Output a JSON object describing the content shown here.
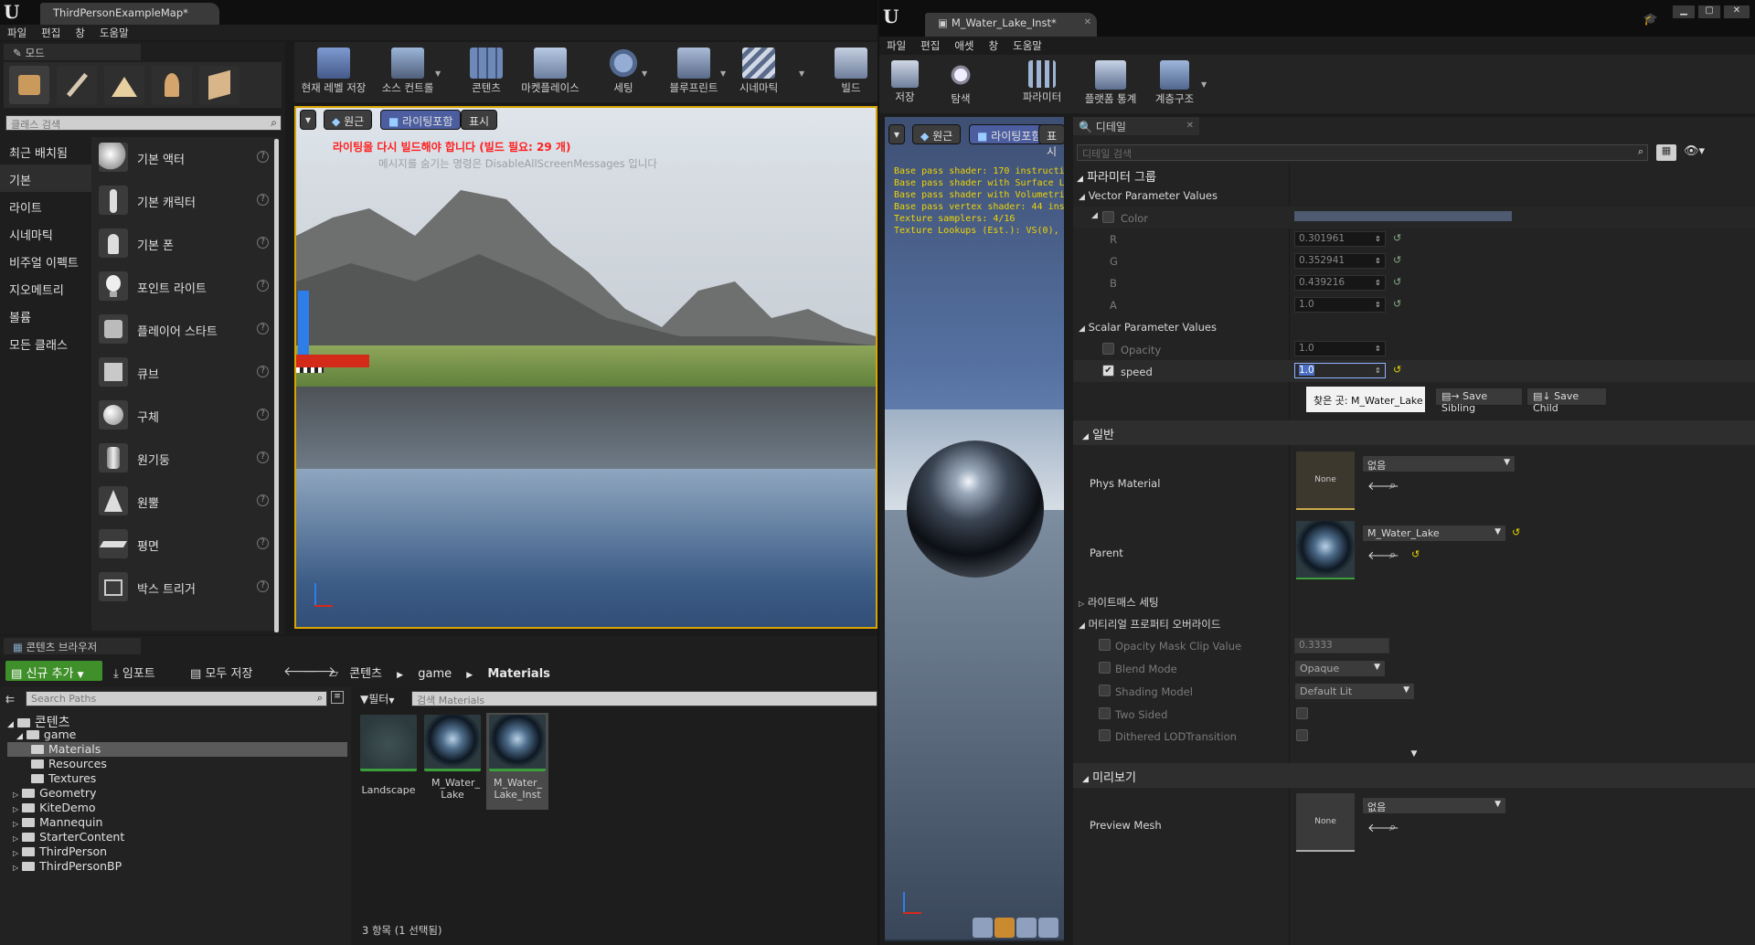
{
  "level_editor": {
    "tab_title": "ThirdPersonExampleMap",
    "tab_title_suffix": "*",
    "menu": [
      "파일",
      "편집",
      "창",
      "도움말"
    ],
    "modes_tab": "모드",
    "class_search_placeholder": "클래스 검색",
    "categories": [
      "최근 배치됨",
      "기본",
      "라이트",
      "시네마틱",
      "비주얼 이펙트",
      "지오메트리",
      "볼륨",
      "모든 클래스"
    ],
    "place_items": [
      "기본 액터",
      "기본 캐릭터",
      "기본 폰",
      "포인트 라이트",
      "플레이어 스타트",
      "큐브",
      "구체",
      "원기둥",
      "원뿔",
      "평면",
      "박스 트리거"
    ],
    "toolbar": [
      "현재 레벨 저장",
      "소스 컨트롤",
      "콘텐츠",
      "마켓플레이스",
      "세팅",
      "블루프린트",
      "시네마틱",
      "빌드"
    ],
    "viewport": {
      "buttons": [
        "원근",
        "라이팅포함",
        "표시"
      ],
      "warning": "라이팅을 다시 빌드해야 합니다 (빌드 필요: 29 개)",
      "hint": "메시지를 숨기는 명령은 DisableAllScreenMessages 입니다"
    },
    "content_browser": {
      "tab": "콘텐츠 브라우저",
      "add_new": "신규 추가",
      "import": "임포트",
      "save_all": "모두 저장",
      "breadcrumb": [
        "콘텐츠",
        "game",
        "Materials"
      ],
      "search_paths_placeholder": "Search Paths",
      "filter_label": "필터",
      "search_assets_placeholder": "검색 Materials",
      "tree": {
        "root": "콘텐츠",
        "game": "game",
        "game_children": [
          "Materials",
          "Resources",
          "Textures"
        ],
        "others": [
          "Geometry",
          "KiteDemo",
          "Mannequin",
          "StarterContent",
          "ThirdPerson",
          "ThirdPersonBP"
        ]
      },
      "assets": [
        {
          "label": "Landscape"
        },
        {
          "label": "M_Water_ Lake"
        },
        {
          "label": "M_Water_ Lake_Inst"
        }
      ],
      "status": "3 항목 (1 선택됨)"
    }
  },
  "material_editor": {
    "tab_title": "M_Water_Lake_Inst*",
    "menu": [
      "파일",
      "편집",
      "애셋",
      "창",
      "도움말"
    ],
    "toolbar": [
      "저장",
      "탐색",
      "파라미터",
      "플랫폼 통계",
      "계층구조"
    ],
    "viewport": {
      "buttons": [
        "원근",
        "라이팅포함",
        "표시"
      ],
      "stats": [
        "Base pass shader: 170 instructions",
        "Base pass shader with Surface Lightmap: 197",
        "Base pass shader with Volumetric Lightmap: 2",
        "Base pass vertex shader: 44 instructions",
        "Texture samplers: 4/16",
        "Texture Lookups (Est.): VS(0), PS(6)"
      ]
    },
    "details": {
      "tab": "디테일",
      "search_placeholder": "디테일 검색",
      "param_groups_title": "파라미터 그룹",
      "vector_group": "Vector Parameter Values",
      "color_label": "Color",
      "channels": [
        {
          "name": "R",
          "value": "0.301961"
        },
        {
          "name": "G",
          "value": "0.352941"
        },
        {
          "name": "B",
          "value": "0.439216"
        },
        {
          "name": "A",
          "value": "1.0"
        }
      ],
      "scalar_group": "Scalar Parameter Values",
      "opacity_label": "Opacity",
      "opacity_value": "1.0",
      "speed_label": "speed",
      "speed_value": "1.0",
      "tooltip": "찾은 곳: M_Water_Lake",
      "save_sibling": "Save Sibling",
      "save_child": "Save Child",
      "general_title": "일반",
      "phys_material_label": "Phys Material",
      "phys_material_value": "없음",
      "none_thumb": "None",
      "parent_label": "Parent",
      "parent_value": "M_Water_Lake",
      "lightmass_label": "라이트매스 세팅",
      "overrides_label": "머티리얼 프로퍼티 오버라이드",
      "opacity_mask_label": "Opacity Mask Clip Value",
      "opacity_mask_value": "0.3333",
      "blend_mode_label": "Blend Mode",
      "blend_mode_value": "Opaque",
      "shading_model_label": "Shading Model",
      "shading_model_value": "Default Lit",
      "two_sided_label": "Two Sided",
      "dithered_label": "Dithered LODTransition",
      "preview_title": "미리보기",
      "preview_mesh_label": "Preview Mesh",
      "preview_mesh_value": "없음"
    }
  },
  "colors": {
    "color_swatch": "#4d5a70",
    "add_new_green": "#3f8f2a",
    "warning_red": "#ff2020",
    "stat_yellow": "#f0d400"
  }
}
